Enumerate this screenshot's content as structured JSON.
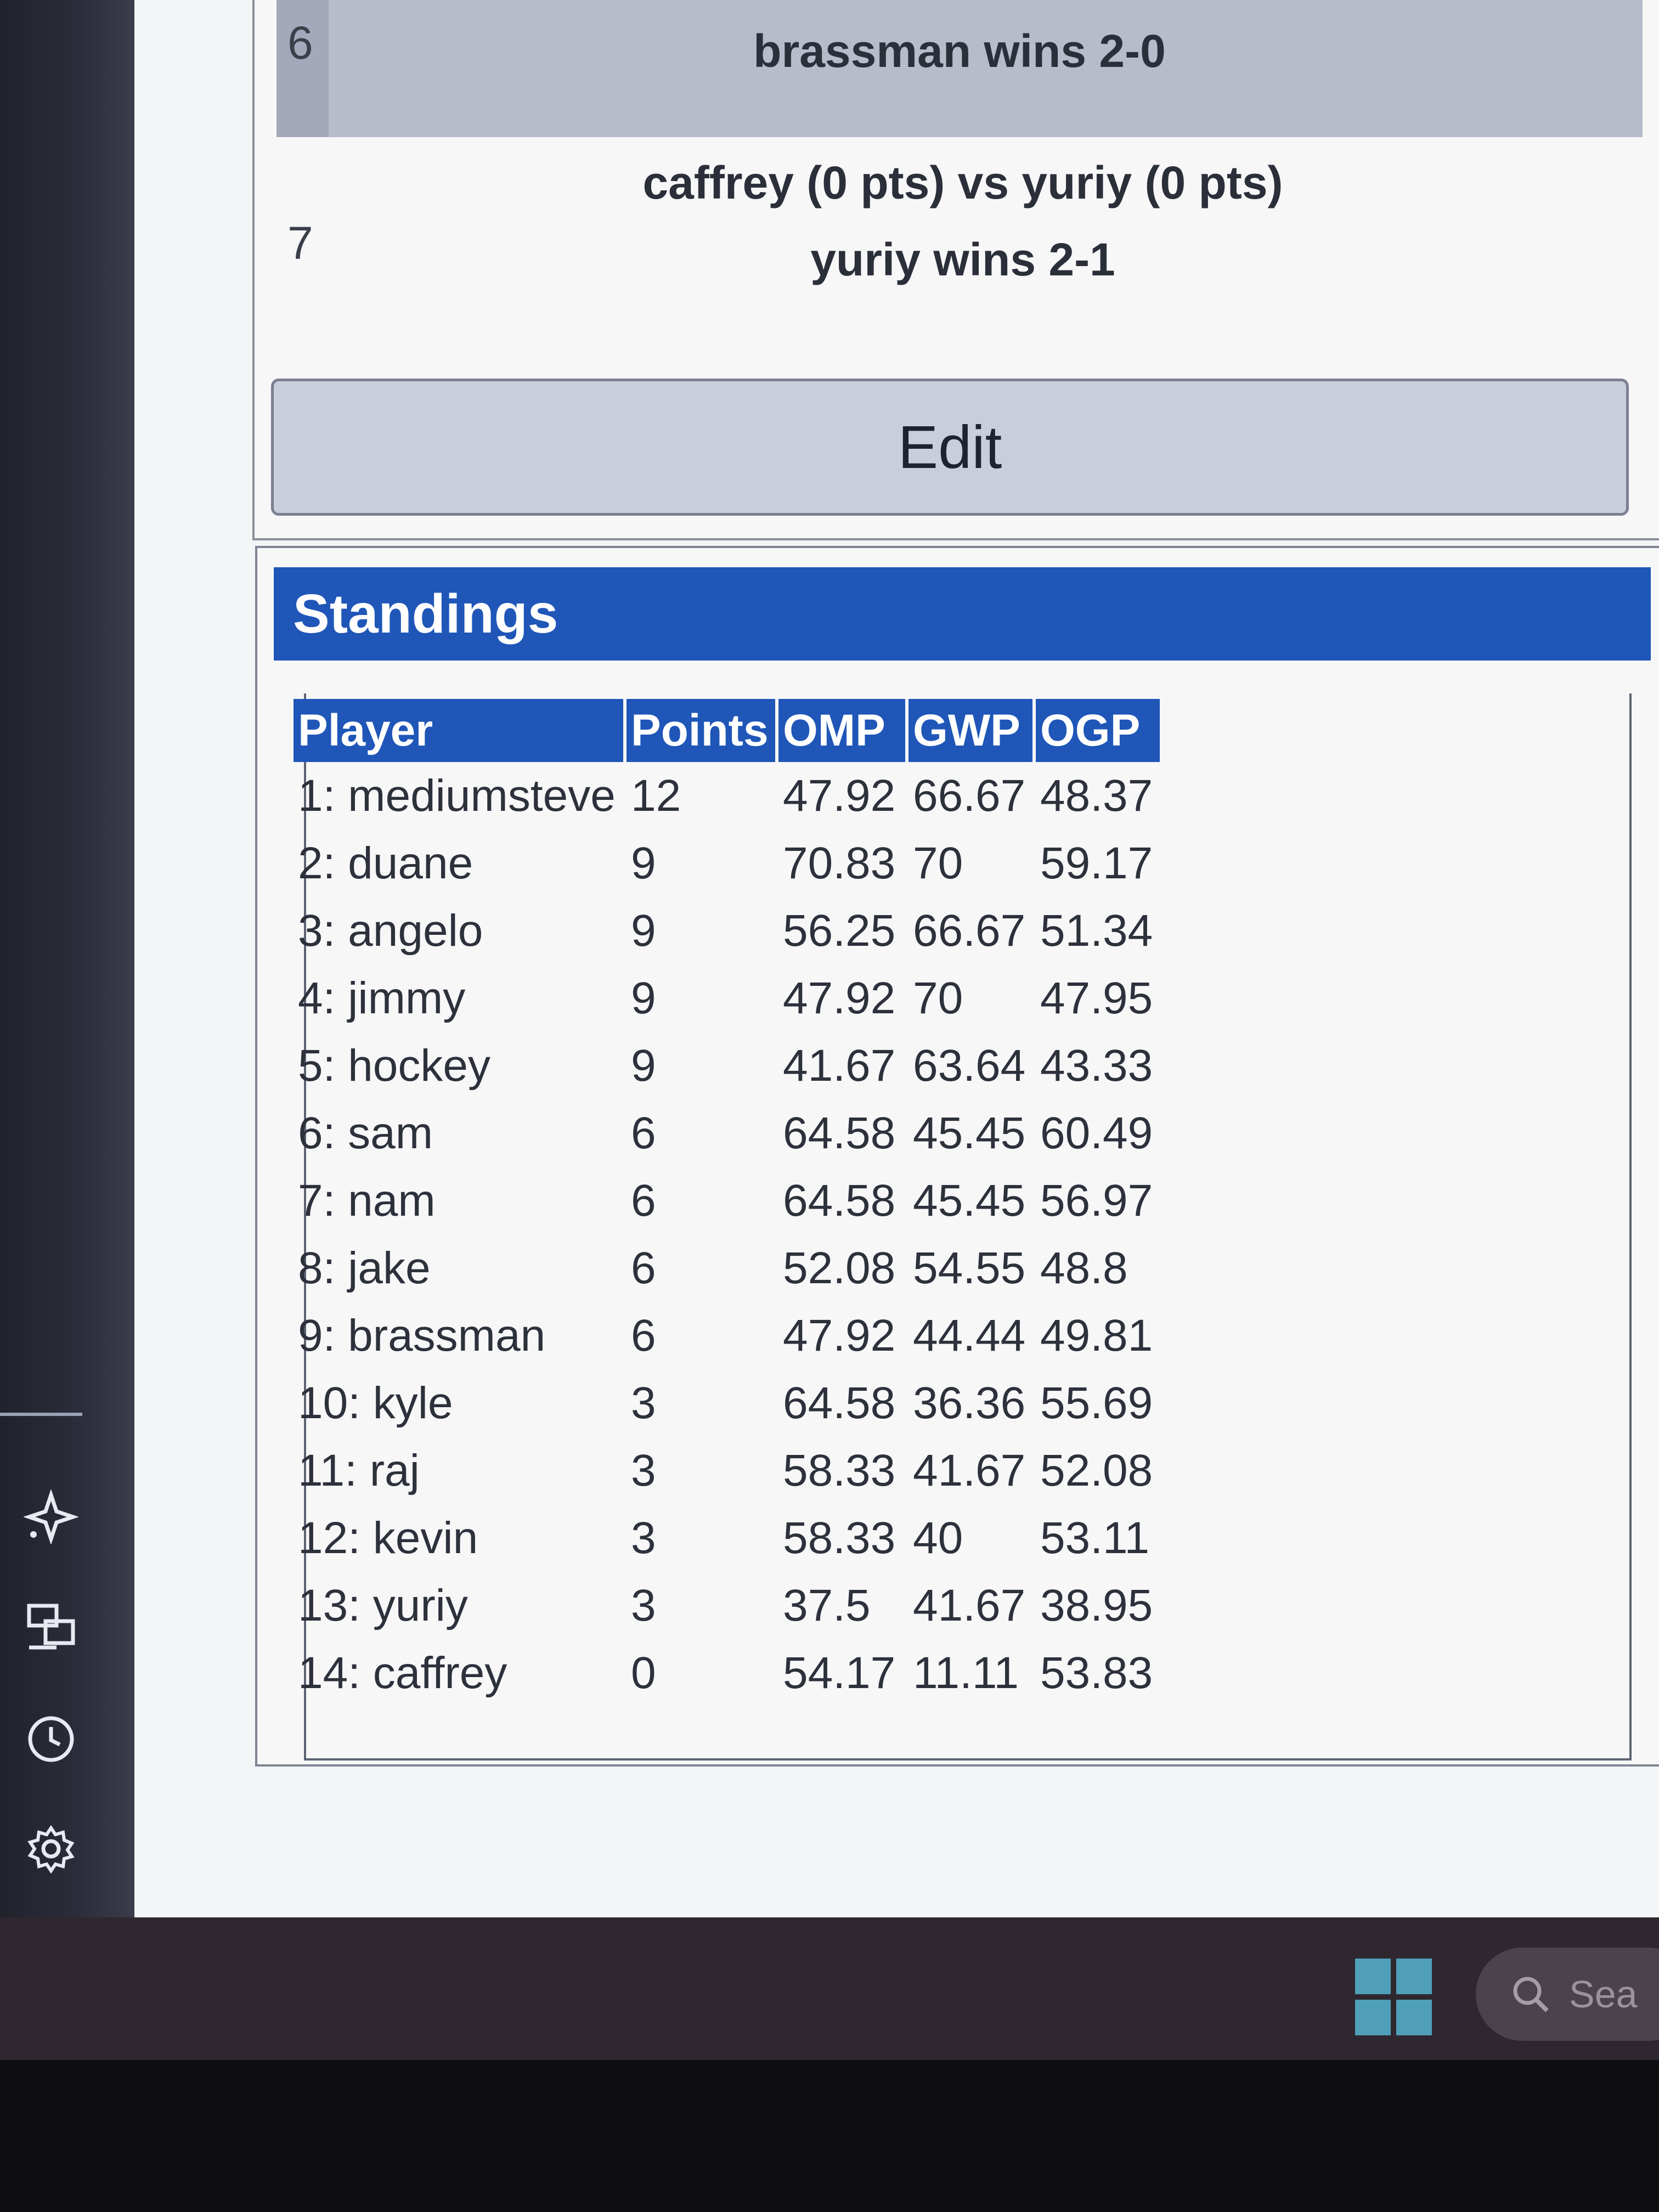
{
  "rail": {
    "icons": [
      "sparkle-icon",
      "device-icon",
      "clock-icon",
      "gear-icon"
    ]
  },
  "rounds": {
    "round6": {
      "number": "6",
      "result": "brassman wins 2-0"
    },
    "round7": {
      "number": "7",
      "pairing": "caffrey (0 pts) vs yuriy (0 pts)",
      "result": "yuriy wins 2-1"
    },
    "edit_label": "Edit"
  },
  "standings": {
    "title": "Standings",
    "columns": [
      "Player",
      "Points",
      "OMP",
      "GWP",
      "OGP"
    ],
    "rows": [
      {
        "player": "1: mediumsteve",
        "points": "12",
        "omp": "47.92",
        "gwp": "66.67",
        "ogp": "48.37"
      },
      {
        "player": "2: duane",
        "points": "9",
        "omp": "70.83",
        "gwp": "70",
        "ogp": "59.17"
      },
      {
        "player": "3: angelo",
        "points": "9",
        "omp": "56.25",
        "gwp": "66.67",
        "ogp": "51.34"
      },
      {
        "player": "4: jimmy",
        "points": "9",
        "omp": "47.92",
        "gwp": "70",
        "ogp": "47.95"
      },
      {
        "player": "5: hockey",
        "points": "9",
        "omp": "41.67",
        "gwp": "63.64",
        "ogp": "43.33"
      },
      {
        "player": "6: sam",
        "points": "6",
        "omp": "64.58",
        "gwp": "45.45",
        "ogp": "60.49"
      },
      {
        "player": "7: nam",
        "points": "6",
        "omp": "64.58",
        "gwp": "45.45",
        "ogp": "56.97"
      },
      {
        "player": "8: jake",
        "points": "6",
        "omp": "52.08",
        "gwp": "54.55",
        "ogp": "48.8"
      },
      {
        "player": "9: brassman",
        "points": "6",
        "omp": "47.92",
        "gwp": "44.44",
        "ogp": "49.81"
      },
      {
        "player": "10: kyle",
        "points": "3",
        "omp": "64.58",
        "gwp": "36.36",
        "ogp": "55.69"
      },
      {
        "player": "11: raj",
        "points": "3",
        "omp": "58.33",
        "gwp": "41.67",
        "ogp": "52.08"
      },
      {
        "player": "12: kevin",
        "points": "3",
        "omp": "58.33",
        "gwp": "40",
        "ogp": "53.11"
      },
      {
        "player": "13: yuriy",
        "points": "3",
        "omp": "37.5",
        "gwp": "41.67",
        "ogp": "38.95"
      },
      {
        "player": "14: caffrey",
        "points": "0",
        "omp": "54.17",
        "gwp": "11.11",
        "ogp": "53.83"
      }
    ]
  },
  "taskbar": {
    "search_text": "Sea"
  },
  "colors": {
    "header_blue": "#1f56b8",
    "shaded_row": "#b7bccb",
    "edit_button": "#c9cedb"
  }
}
